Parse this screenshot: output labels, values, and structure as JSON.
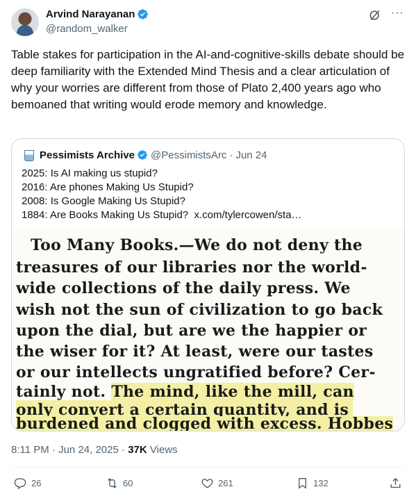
{
  "author": {
    "name": "Arvind Narayanan",
    "handle": "@random_walker"
  },
  "header_icons": [
    "verified-badge-icon",
    "grok-icon",
    "more-options-icon"
  ],
  "more_label": "···",
  "tweet_text": "Table stakes for participation in the AI-and-cognitive-skills debate should be deep familiarity with the Extended Mind Thesis and a clear articulation of why your worries are different from those of Plato 2,400 years ago who bemoaned that writing would erode memory and knowledge.",
  "quoted": {
    "name": "Pessimists Archive",
    "handle": "@PessimistsArc",
    "separator": "·",
    "date": "Jun 24",
    "lines": [
      "2025: Is AI making us stupid?",
      "2016: Are phones Making Us Stupid?",
      "2008: Is Google Making Us Stupid?",
      "1884: Are Books Making Us Stupid?"
    ],
    "link": "x.com/tylercowen/sta…",
    "clipping": {
      "lines": [
        "Too Many Books.—We do not deny the",
        "treasures of our libraries nor the world-",
        "wide collections of the daily press. We",
        "wish not the sun of civilization to go back",
        "upon the dial, but are we the happier or",
        "the wiser for it? At least, were our tastes",
        "or our intellects ungratified before? Cer-",
        "tainly not.",
        "The mind, like the mill, can",
        "only convert a certain quantity, and is",
        "burdened and clogged with excess. Hobbes"
      ],
      "highlight_color": "#f3f0a6"
    }
  },
  "meta": {
    "time": "8:11 PM",
    "dot": "·",
    "date": "Jun 24, 2025",
    "views_count": "37K",
    "views_label": "Views"
  },
  "actions": {
    "replies": "26",
    "reposts": "60",
    "likes": "261",
    "bookmarks": "132"
  },
  "colors": {
    "text": "#0f1419",
    "secondary": "#536471",
    "verified": "#1d9bf0",
    "border": "#cfd9de"
  }
}
